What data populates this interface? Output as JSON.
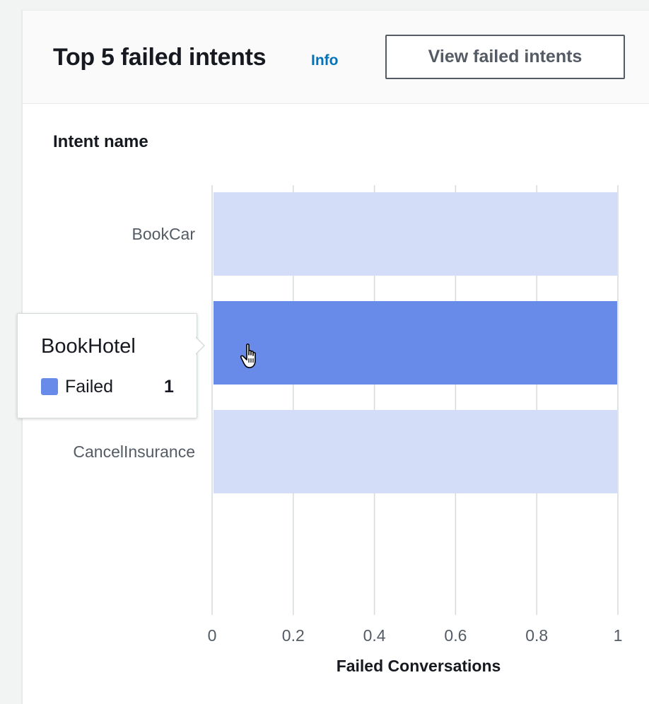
{
  "header": {
    "title": "Top 5 failed intents",
    "info_label": "Info",
    "view_button_label": "View failed intents"
  },
  "chart": {
    "column_header": "Intent name"
  },
  "tooltip": {
    "title": "BookHotel",
    "series_label": "Failed",
    "value": "1"
  },
  "colors": {
    "highlight_bar": "#688ae8",
    "faded_bar": "#d4ddf7",
    "link": "#0073bb",
    "gridline": "#d5dbdb"
  },
  "icons": {
    "cursor": "hand-pointer-icon"
  },
  "chart_data": {
    "type": "bar",
    "orientation": "horizontal",
    "categories": [
      "BookCar",
      "BookHotel",
      "CancelInsurance"
    ],
    "series": [
      {
        "name": "Failed",
        "values": [
          1,
          1,
          1
        ]
      }
    ],
    "highlighted_category": "BookHotel",
    "xlabel": "Failed Conversations",
    "ylabel": "Intent name",
    "xlim": [
      0,
      1
    ],
    "xticks": [
      "0",
      "0.2",
      "0.4",
      "0.6",
      "0.8",
      "1"
    ],
    "grid": true,
    "legend": "none"
  }
}
